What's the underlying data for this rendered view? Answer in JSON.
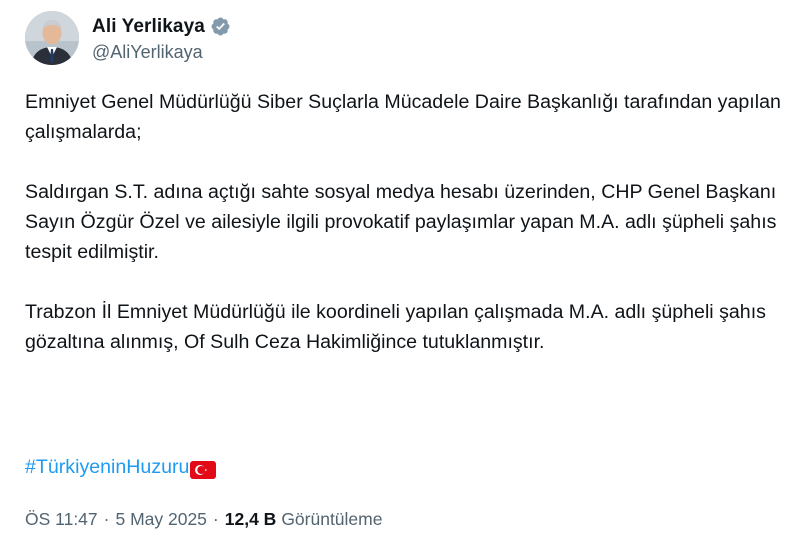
{
  "author": {
    "display_name": "Ali Yerlikaya",
    "handle": "@AliYerlikaya",
    "verified_icon": "verified-badge-icon",
    "verified_color": "#829aab",
    "avatar_icon": "profile-photo"
  },
  "tweet": {
    "paragraphs": [
      "Emniyet Genel Müdürlüğü Siber Suçlarla Mücadele Daire Başkanlığı tarafından yapılan çalışmalarda;",
      "Saldırgan S.T. adına açtığı sahte sosyal medya hesabı üzerinden, CHP Genel Başkanı Sayın Özgür Özel ve ailesiyle ilgili provokatif paylaşımlar yapan M.A. adlı şüpheli şahıs tespit edilmiştir.",
      "Trabzon İl Emniyet Müdürlüğü ile koordineli yapılan çalışmada M.A. adlı şüpheli şahıs  gözaltına alınmış, Of Sulh Ceza Hakimliğince tutuklanmıştır."
    ],
    "hashtag": "#TürkiyeninHuzuru",
    "hashtag_color": "#1d9bf0",
    "flag_icon": "turkey-flag-icon"
  },
  "meta": {
    "time": "ÖS 11:47",
    "separator": "·",
    "date": "5 May 2025",
    "views_count": "12,4 B",
    "views_label": "Görüntüleme"
  }
}
